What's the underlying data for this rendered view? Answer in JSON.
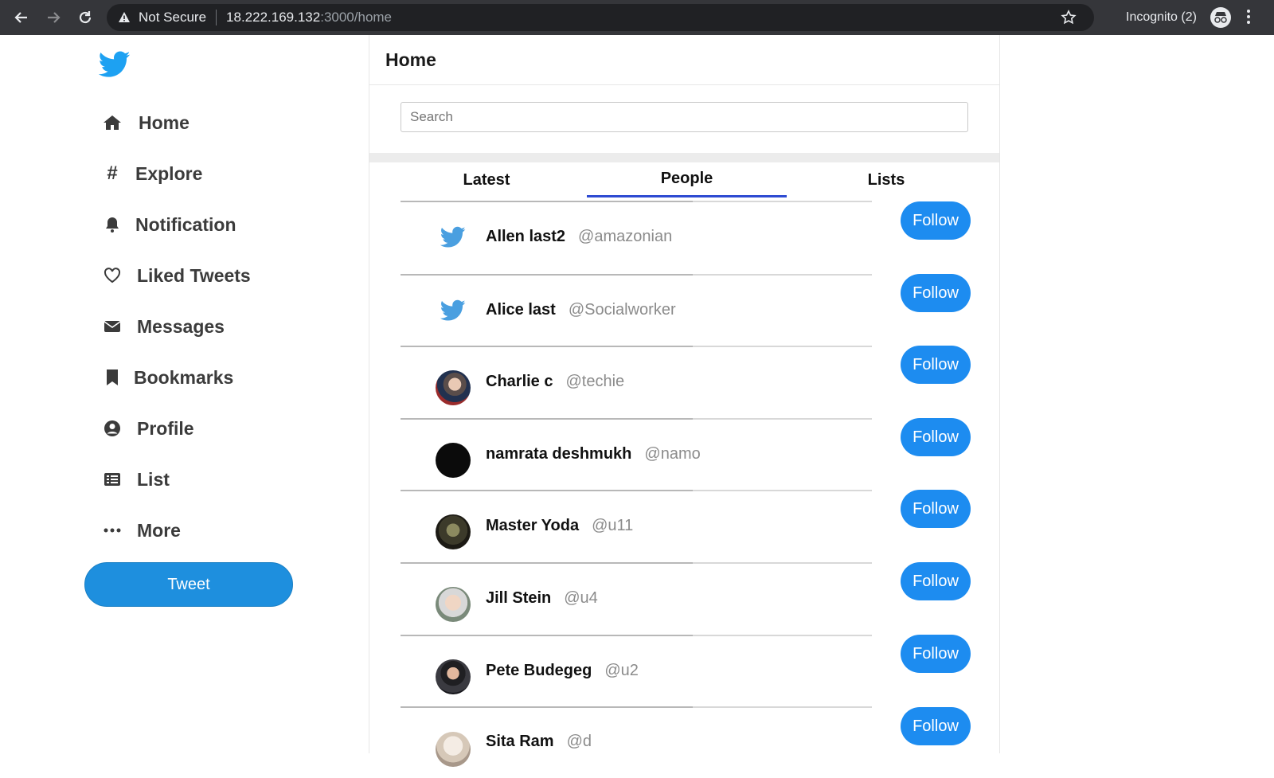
{
  "browser": {
    "security_label": "Not Secure",
    "url_host": "18.222.169.132",
    "url_path": ":3000/home",
    "incognito_label": "Incognito (2)"
  },
  "sidebar": {
    "items": [
      {
        "label": "Home",
        "icon": "home-icon"
      },
      {
        "label": "Explore",
        "icon": "hashtag-icon"
      },
      {
        "label": "Notification",
        "icon": "bell-icon"
      },
      {
        "label": "Liked Tweets",
        "icon": "heart-icon"
      },
      {
        "label": "Messages",
        "icon": "envelope-icon"
      },
      {
        "label": "Bookmarks",
        "icon": "bookmark-icon"
      },
      {
        "label": "Profile",
        "icon": "user-circle-icon"
      },
      {
        "label": "List",
        "icon": "list-icon"
      },
      {
        "label": "More",
        "icon": "ellipsis-icon"
      }
    ],
    "tweet_label": "Tweet"
  },
  "main": {
    "title": "Home",
    "search_placeholder": "Search",
    "tabs": [
      {
        "label": "Latest"
      },
      {
        "label": "People"
      },
      {
        "label": "Lists"
      }
    ],
    "active_tab": "People",
    "users": [
      {
        "name": "Allen last2",
        "handle": "@amazonian",
        "avatar": "twitter-bird",
        "follow": "Follow"
      },
      {
        "name": "Alice last",
        "handle": "@Socialworker",
        "avatar": "twitter-bird",
        "follow": "Follow"
      },
      {
        "name": "Charlie c",
        "handle": "@techie",
        "avatar": "photo",
        "follow": "Follow"
      },
      {
        "name": "namrata deshmukh",
        "handle": "@namo",
        "avatar": "black",
        "follow": "Follow"
      },
      {
        "name": "Master Yoda",
        "handle": "@u11",
        "avatar": "photo",
        "follow": "Follow"
      },
      {
        "name": "Jill Stein",
        "handle": "@u4",
        "avatar": "photo",
        "follow": "Follow"
      },
      {
        "name": "Pete Budegeg",
        "handle": "@u2",
        "avatar": "photo",
        "follow": "Follow"
      },
      {
        "name": "Sita Ram",
        "handle": "@d",
        "avatar": "photo",
        "follow": "Follow"
      }
    ]
  },
  "colors": {
    "brand": "#1da1f2",
    "follow": "#1d8cf0",
    "tweet": "#1e8fde",
    "tab_underline": "#2e4bd2"
  }
}
